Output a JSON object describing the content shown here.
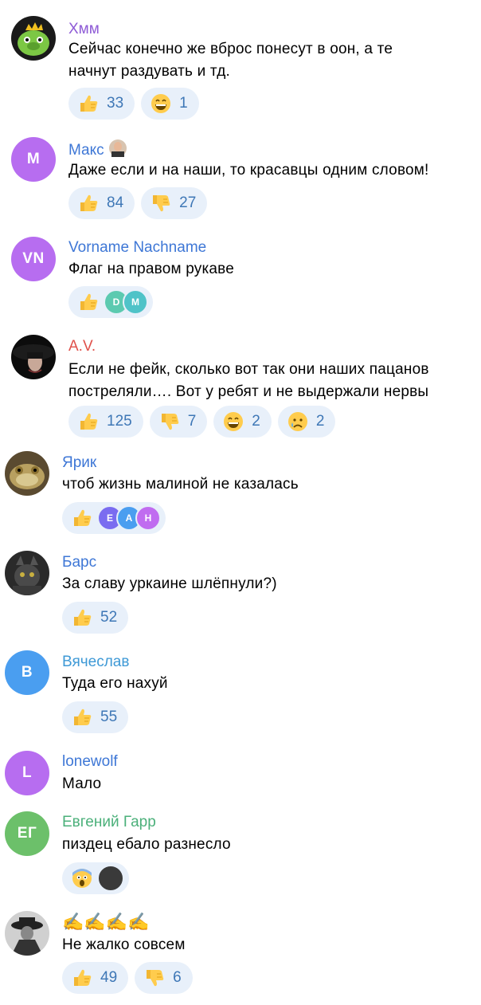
{
  "comments": [
    {
      "author": "Хмм",
      "author_color": "#8e5bd6",
      "avatar": {
        "type": "picture",
        "name": "green-pig-avatar"
      },
      "text": [
        "Сейчас конечно же вброс понесут в оон, а те",
        "начнут раздувать и тд."
      ],
      "reactions": [
        {
          "emoji": "thumbs-up",
          "count": "33"
        },
        {
          "emoji": "grin",
          "count": "1"
        }
      ]
    },
    {
      "author": "Макс",
      "author_color": "#3e77d6",
      "avatar": {
        "type": "initials",
        "initials": "M",
        "color": "#b76df0"
      },
      "text": [
        "Даже если и на наши, то красавцы одним словом!"
      ],
      "reactions": [
        {
          "emoji": "thumbs-up",
          "count": "84"
        },
        {
          "emoji": "thumbs-down",
          "count": "27"
        }
      ]
    },
    {
      "author": "Vorname Nachname",
      "author_color": "#3e77d6",
      "avatar": {
        "type": "initials",
        "initials": "VN",
        "color": "#b76df0"
      },
      "text": [
        "Флаг на правом рукаве"
      ],
      "reactions": [
        {
          "emoji": "thumbs-up",
          "avatars": [
            {
              "initials": "D",
              "color": "#5ccab0"
            },
            {
              "initials": "M",
              "color": "#4fc3c8"
            }
          ]
        }
      ]
    },
    {
      "author": "A.V.",
      "author_color": "#e0514b",
      "avatar": {
        "type": "picture",
        "name": "dark-hat-avatar"
      },
      "text": [
        "Если не фейк, сколько вот так они наших пацанов",
        "постреляли…. Вот у ребят и не выдержали нервы"
      ],
      "reactions": [
        {
          "emoji": "thumbs-up",
          "count": "125"
        },
        {
          "emoji": "thumbs-down",
          "count": "7"
        },
        {
          "emoji": "grin",
          "count": "2"
        },
        {
          "emoji": "crying",
          "count": "2"
        }
      ]
    },
    {
      "author": "Ярик",
      "author_color": "#3e77d6",
      "avatar": {
        "type": "picture",
        "name": "toad-avatar"
      },
      "text": [
        "чтоб жизнь малиной не казалась"
      ],
      "reactions": [
        {
          "emoji": "thumbs-up",
          "avatars": [
            {
              "initials": "E",
              "color": "#7a6cf0"
            },
            {
              "initials": "A",
              "color": "#4a9ef0"
            },
            {
              "initials": "H",
              "color": "#c06cf0"
            }
          ]
        }
      ]
    },
    {
      "author": "Барс",
      "author_color": "#3e77d6",
      "avatar": {
        "type": "picture",
        "name": "cat-avatar"
      },
      "text": [
        "За славу уркаине шлёпнули?)"
      ],
      "reactions": [
        {
          "emoji": "thumbs-up",
          "count": "52"
        }
      ]
    },
    {
      "author": "Вячеслав",
      "author_color": "#3e99d6",
      "avatar": {
        "type": "initials",
        "initials": "B",
        "color": "#4a9ef0"
      },
      "text": [
        "Туда его нахуй"
      ],
      "reactions": [
        {
          "emoji": "thumbs-up",
          "count": "55"
        }
      ]
    },
    {
      "author": "lonewolf",
      "author_color": "#3e77d6",
      "avatar": {
        "type": "initials",
        "initials": "L",
        "color": "#b76df0"
      },
      "text": [
        "Мало"
      ],
      "reactions": []
    },
    {
      "author": "Евгений Гарр",
      "author_color": "#4bb07a",
      "avatar": {
        "type": "initials",
        "initials": "ЕГ",
        "color": "#6cc06a"
      },
      "text": [
        "пиздец ебало разнесло"
      ],
      "reactions": [
        {
          "emoji": "scream",
          "avatars": [
            {
              "initials": "",
              "color": "#3a3a3a"
            }
          ]
        }
      ]
    },
    {
      "author": "✍️✍️✍️✍️",
      "author_color": "#000000",
      "avatar": {
        "type": "picture",
        "name": "mystery-man-avatar"
      },
      "text": [
        "Не жалко совсем"
      ],
      "reactions": [
        {
          "emoji": "thumbs-up",
          "count": "49"
        },
        {
          "emoji": "thumbs-down",
          "count": "6"
        }
      ]
    }
  ]
}
